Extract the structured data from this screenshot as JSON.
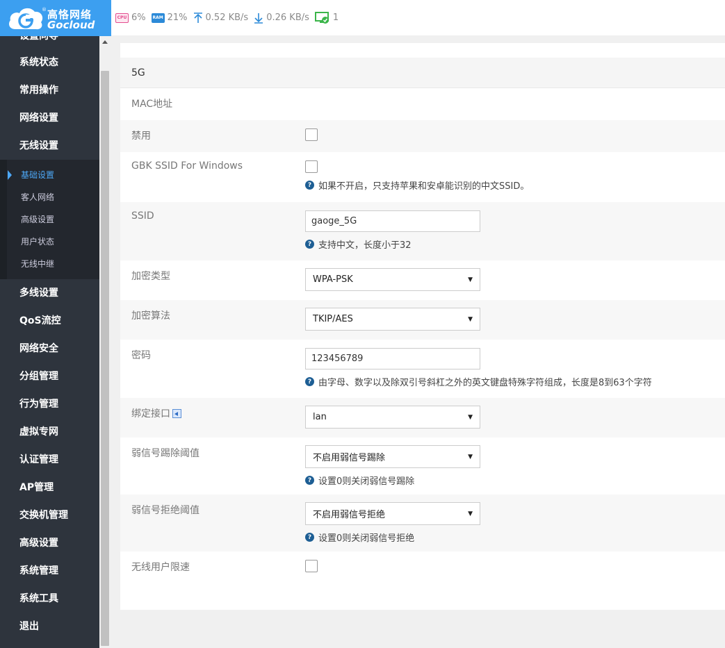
{
  "brand": {
    "name_cn": "高恪网络",
    "name_en": "Gocloud",
    "reg": "®"
  },
  "topbar": {
    "cpu_label": "CPU",
    "cpu": "6%",
    "ram_label": "RAM",
    "ram": "21%",
    "upload": "0.52 KB/s",
    "download": "0.26 KB/s",
    "online": "1"
  },
  "sidebar": {
    "partial": "设置向导",
    "items": [
      "系统状态",
      "常用操作",
      "网络设置",
      "无线设置"
    ],
    "sub": [
      "基础设置",
      "客人网络",
      "高级设置",
      "用户状态",
      "无线中继"
    ],
    "items2": [
      "多线设置",
      "QoS流控",
      "网络安全",
      "分组管理",
      "行为管理",
      "虚拟专网",
      "认证管理",
      "AP管理",
      "交换机管理",
      "高级设置",
      "系统管理",
      "系统工具",
      "退出"
    ]
  },
  "form": {
    "section": "5G",
    "mac_label": "MAC地址",
    "disable_label": "禁用",
    "gbk_label": "GBK SSID For Windows",
    "gbk_help": "如果不开启，只支持苹果和安卓能识别的中文SSID。",
    "ssid_label": "SSID",
    "ssid_value": "gaoge_5G",
    "ssid_help": "支持中文，长度小于32",
    "enc_type_label": "加密类型",
    "enc_type_value": "WPA-PSK",
    "enc_alg_label": "加密算法",
    "enc_alg_value": "TKIP/AES",
    "pwd_label": "密码",
    "pwd_value": "123456789",
    "pwd_help": "由字母、数字以及除双引号斜杠之外的英文键盘特殊字符组成，长度是8到63个字符",
    "bind_label": "绑定接口",
    "bind_value": "lan",
    "kick_label": "弱信号踢除阈值",
    "kick_value": "不启用弱信号踢除",
    "kick_help": "设置0则关闭弱信号踢除",
    "reject_label": "弱信号拒绝阈值",
    "reject_value": "不启用弱信号拒绝",
    "reject_help": "设置0则关闭弱信号拒绝",
    "ratelimit_label": "无线用户限速"
  },
  "colors": {
    "accent": "#3c9ff0",
    "sidebar": "#2e343d",
    "active": "#4da8f7"
  }
}
